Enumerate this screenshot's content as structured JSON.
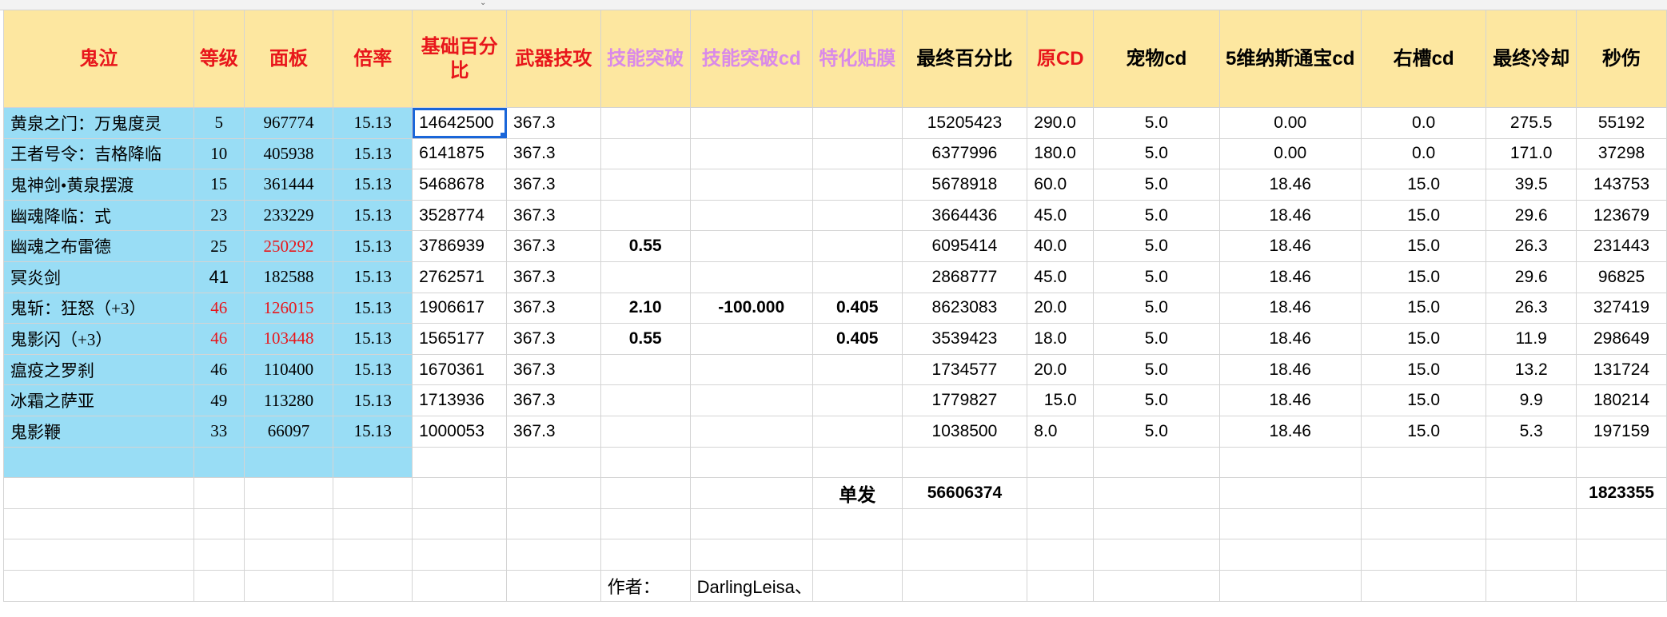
{
  "headers": [
    "鬼泣",
    "等级",
    "面板",
    "倍率",
    "基础百分比",
    "武器技攻",
    "技能突破",
    "技能突破cd",
    "特化贴膜",
    "最终百分比",
    "原CD",
    "宠物cd",
    "5维纳斯通宝cd",
    "右槽cd",
    "最终冷却",
    "秒伤"
  ],
  "rows": [
    [
      "黄泉之门：万鬼度灵",
      "5",
      "967774",
      "15.13",
      "14642500",
      "367.3",
      "",
      "",
      "",
      "15205423",
      "290.0",
      "5.0",
      "0.00",
      "0.0",
      "275.5",
      "55192"
    ],
    [
      "王者号令：吉格降临",
      "10",
      "405938",
      "15.13",
      "6141875",
      "367.3",
      "",
      "",
      "",
      "6377996",
      "180.0",
      "5.0",
      "0.00",
      "0.0",
      "171.0",
      "37298"
    ],
    [
      "鬼神剑•黄泉摆渡",
      "15",
      "361444",
      "15.13",
      "5468678",
      "367.3",
      "",
      "",
      "",
      "5678918",
      "60.0",
      "5.0",
      "18.46",
      "15.0",
      "39.5",
      "143753"
    ],
    [
      "幽魂降临：式",
      "23",
      "233229",
      "15.13",
      "3528774",
      "367.3",
      "",
      "",
      "",
      "3664436",
      "45.0",
      "5.0",
      "18.46",
      "15.0",
      "29.6",
      "123679"
    ],
    [
      "幽魂之布雷德",
      "25",
      "250292",
      "15.13",
      "3786939",
      "367.3",
      "0.55",
      "",
      "",
      "6095414",
      "40.0",
      "5.0",
      "18.46",
      "15.0",
      "26.3",
      "231443"
    ],
    [
      "冥炎剑",
      "41",
      "182588",
      "15.13",
      "2762571",
      "367.3",
      "",
      "",
      "",
      "2868777",
      "45.0",
      "5.0",
      "18.46",
      "15.0",
      "29.6",
      "96825"
    ],
    [
      "鬼斩：狂怒（+3）",
      "46",
      "126015",
      "15.13",
      "1906617",
      "367.3",
      "2.10",
      "-100.000",
      "0.405",
      "8623083",
      "20.0",
      "5.0",
      "18.46",
      "15.0",
      "26.3",
      "327419"
    ],
    [
      "鬼影闪（+3）",
      "46",
      "103448",
      "15.13",
      "1565177",
      "367.3",
      "0.55",
      "",
      "0.405",
      "3539423",
      "18.0",
      "5.0",
      "18.46",
      "15.0",
      "11.9",
      "298649"
    ],
    [
      "瘟疫之罗刹",
      "46",
      "110400",
      "15.13",
      "1670361",
      "367.3",
      "",
      "",
      "",
      "1734577",
      "20.0",
      "5.0",
      "18.46",
      "15.0",
      "13.2",
      "131724"
    ],
    [
      "冰霜之萨亚",
      "49",
      "113280",
      "15.13",
      "1713936",
      "367.3",
      "",
      "",
      "",
      "1779827",
      "15.0",
      "5.0",
      "18.46",
      "15.0",
      "9.9",
      "180214"
    ],
    [
      "鬼影鞭",
      "33",
      "66097",
      "15.13",
      "1000053",
      "367.3",
      "",
      "",
      "",
      "1038500",
      "8.0",
      "5.0",
      "18.46",
      "15.0",
      "5.3",
      "197159"
    ]
  ],
  "summary": {
    "label": "单发",
    "total_percent": "56606374",
    "total_dps": "1823355"
  },
  "author": {
    "label": "作者：",
    "name": "DarlingLeisa、"
  }
}
